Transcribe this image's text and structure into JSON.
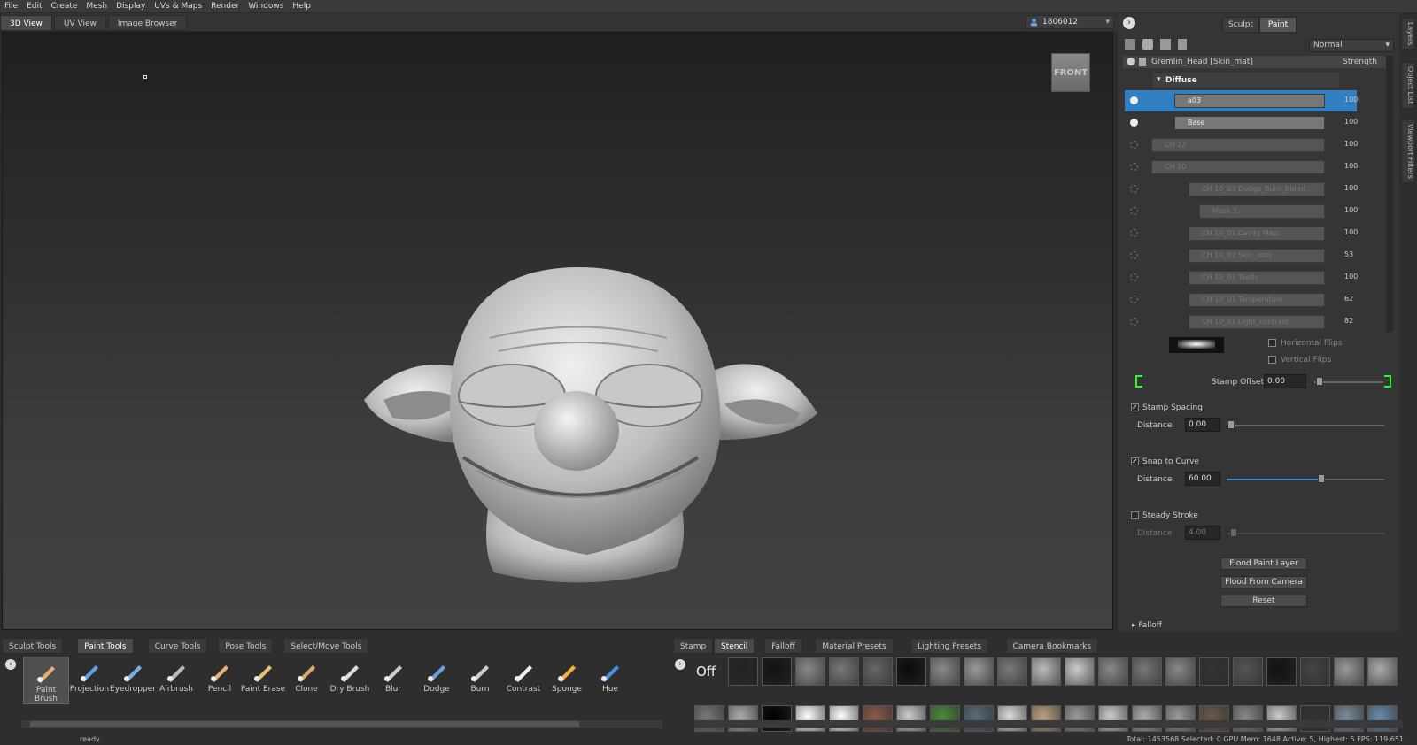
{
  "menu": [
    "File",
    "Edit",
    "Create",
    "Mesh",
    "Display",
    "UVs & Maps",
    "Render",
    "Windows",
    "Help"
  ],
  "view_tabs": [
    {
      "label": "3D View",
      "active": true
    },
    {
      "label": "UV View",
      "active": false
    },
    {
      "label": "Image Browser",
      "active": false
    }
  ],
  "user_selector": "1806012",
  "view_cube_label": "FRONT",
  "mode_tabs": [
    {
      "label": "Sculpt",
      "active": false
    },
    {
      "label": "Paint",
      "active": true
    }
  ],
  "blend_mode": "Normal",
  "layers_header": {
    "name": "Gremlin_Head [Skin_mat]",
    "strength_label": "Strength"
  },
  "channel_label": "Diffuse",
  "layers": [
    {
      "name": "a03",
      "strength": "100",
      "visible": true,
      "selected": true
    },
    {
      "name": "Base",
      "strength": "100",
      "visible": true,
      "selected": false
    },
    {
      "name": "CH 12",
      "strength": "100",
      "visible": false,
      "selected": false
    },
    {
      "name": "CH 10",
      "strength": "100",
      "visible": false,
      "selected": false
    },
    {
      "name": "CH 10_03 Dodge_Burn_Blemi...",
      "strength": "100",
      "visible": false,
      "selected": false
    },
    {
      "name": "Mask 1",
      "strength": "100",
      "visible": false,
      "selected": false
    },
    {
      "name": "CH 10_01 Cavity Map",
      "strength": "100",
      "visible": false,
      "selected": false
    },
    {
      "name": "CH 10_02 Skin_dots",
      "strength": "53",
      "visible": false,
      "selected": false
    },
    {
      "name": "CH 10_01 Teeth",
      "strength": "100",
      "visible": false,
      "selected": false
    },
    {
      "name": "CH 10_01 Temperature",
      "strength": "62",
      "visible": false,
      "selected": false
    },
    {
      "name": "CH 10_01 Light_contrast",
      "strength": "82",
      "visible": false,
      "selected": false
    }
  ],
  "props": {
    "horizontal_flips": "Horizontal Flips",
    "vertical_flips": "Vertical Flips",
    "stamp_offset_label": "Stamp Offset",
    "stamp_offset": "0.00",
    "stamp_spacing_label": "Stamp Spacing",
    "stamp_spacing_checked": true,
    "distance_label": "Distance",
    "stamp_spacing_distance": "0.00",
    "snap_to_curve_label": "Snap to Curve",
    "snap_checked": true,
    "snap_distance": "60.00",
    "snap_distance_fraction": 0.6,
    "steady_stroke_label": "Steady Stroke",
    "steady_checked": false,
    "steady_distance": "4.00",
    "flood_paint_layer": "Flood Paint Layer",
    "flood_from_camera": "Flood From Camera",
    "reset": "Reset",
    "falloff_label": "Falloff"
  },
  "tool_tabs": [
    {
      "label": "Sculpt Tools",
      "active": false
    },
    {
      "label": "Paint Tools",
      "active": true
    },
    {
      "label": "Curve Tools",
      "active": false
    },
    {
      "label": "Pose Tools",
      "active": false
    },
    {
      "label": "Select/Move Tools",
      "active": false
    }
  ],
  "tools": [
    {
      "label": "Paint Brush",
      "icon": "paint-brush-icon",
      "active": true
    },
    {
      "label": "Projection",
      "icon": "projection-icon",
      "active": false
    },
    {
      "label": "Eyedropper",
      "icon": "eyedropper-icon",
      "active": false
    },
    {
      "label": "Airbrush",
      "icon": "airbrush-icon",
      "active": false
    },
    {
      "label": "Pencil",
      "icon": "pencil-icon",
      "active": false
    },
    {
      "label": "Paint Erase",
      "icon": "paint-erase-icon",
      "active": false
    },
    {
      "label": "Clone",
      "icon": "clone-icon",
      "active": false
    },
    {
      "label": "Dry Brush",
      "icon": "dry-brush-icon",
      "active": false
    },
    {
      "label": "Blur",
      "icon": "blur-icon",
      "active": false
    },
    {
      "label": "Dodge",
      "icon": "dodge-icon",
      "active": false
    },
    {
      "label": "Burn",
      "icon": "burn-icon",
      "active": false
    },
    {
      "label": "Contrast",
      "icon": "contrast-icon",
      "active": false
    },
    {
      "label": "Sponge",
      "icon": "sponge-icon",
      "active": false
    },
    {
      "label": "Hue",
      "icon": "hue-icon",
      "active": false
    }
  ],
  "shelf_tabs": [
    {
      "label": "Stamp",
      "active": false
    },
    {
      "label": "Stencil",
      "active": true
    },
    {
      "label": "Falloff",
      "active": false
    },
    {
      "label": "Material Presets",
      "active": false
    },
    {
      "label": "Lighting Presets",
      "active": false
    },
    {
      "label": "Camera Bookmarks",
      "active": false
    }
  ],
  "stencil_off": "Off",
  "status_left": "ready",
  "status_right": "Total: 1453568 Selected: 0 GPU Mem: 1648 Active: 5, Highest: 5 FPS: 119.651"
}
